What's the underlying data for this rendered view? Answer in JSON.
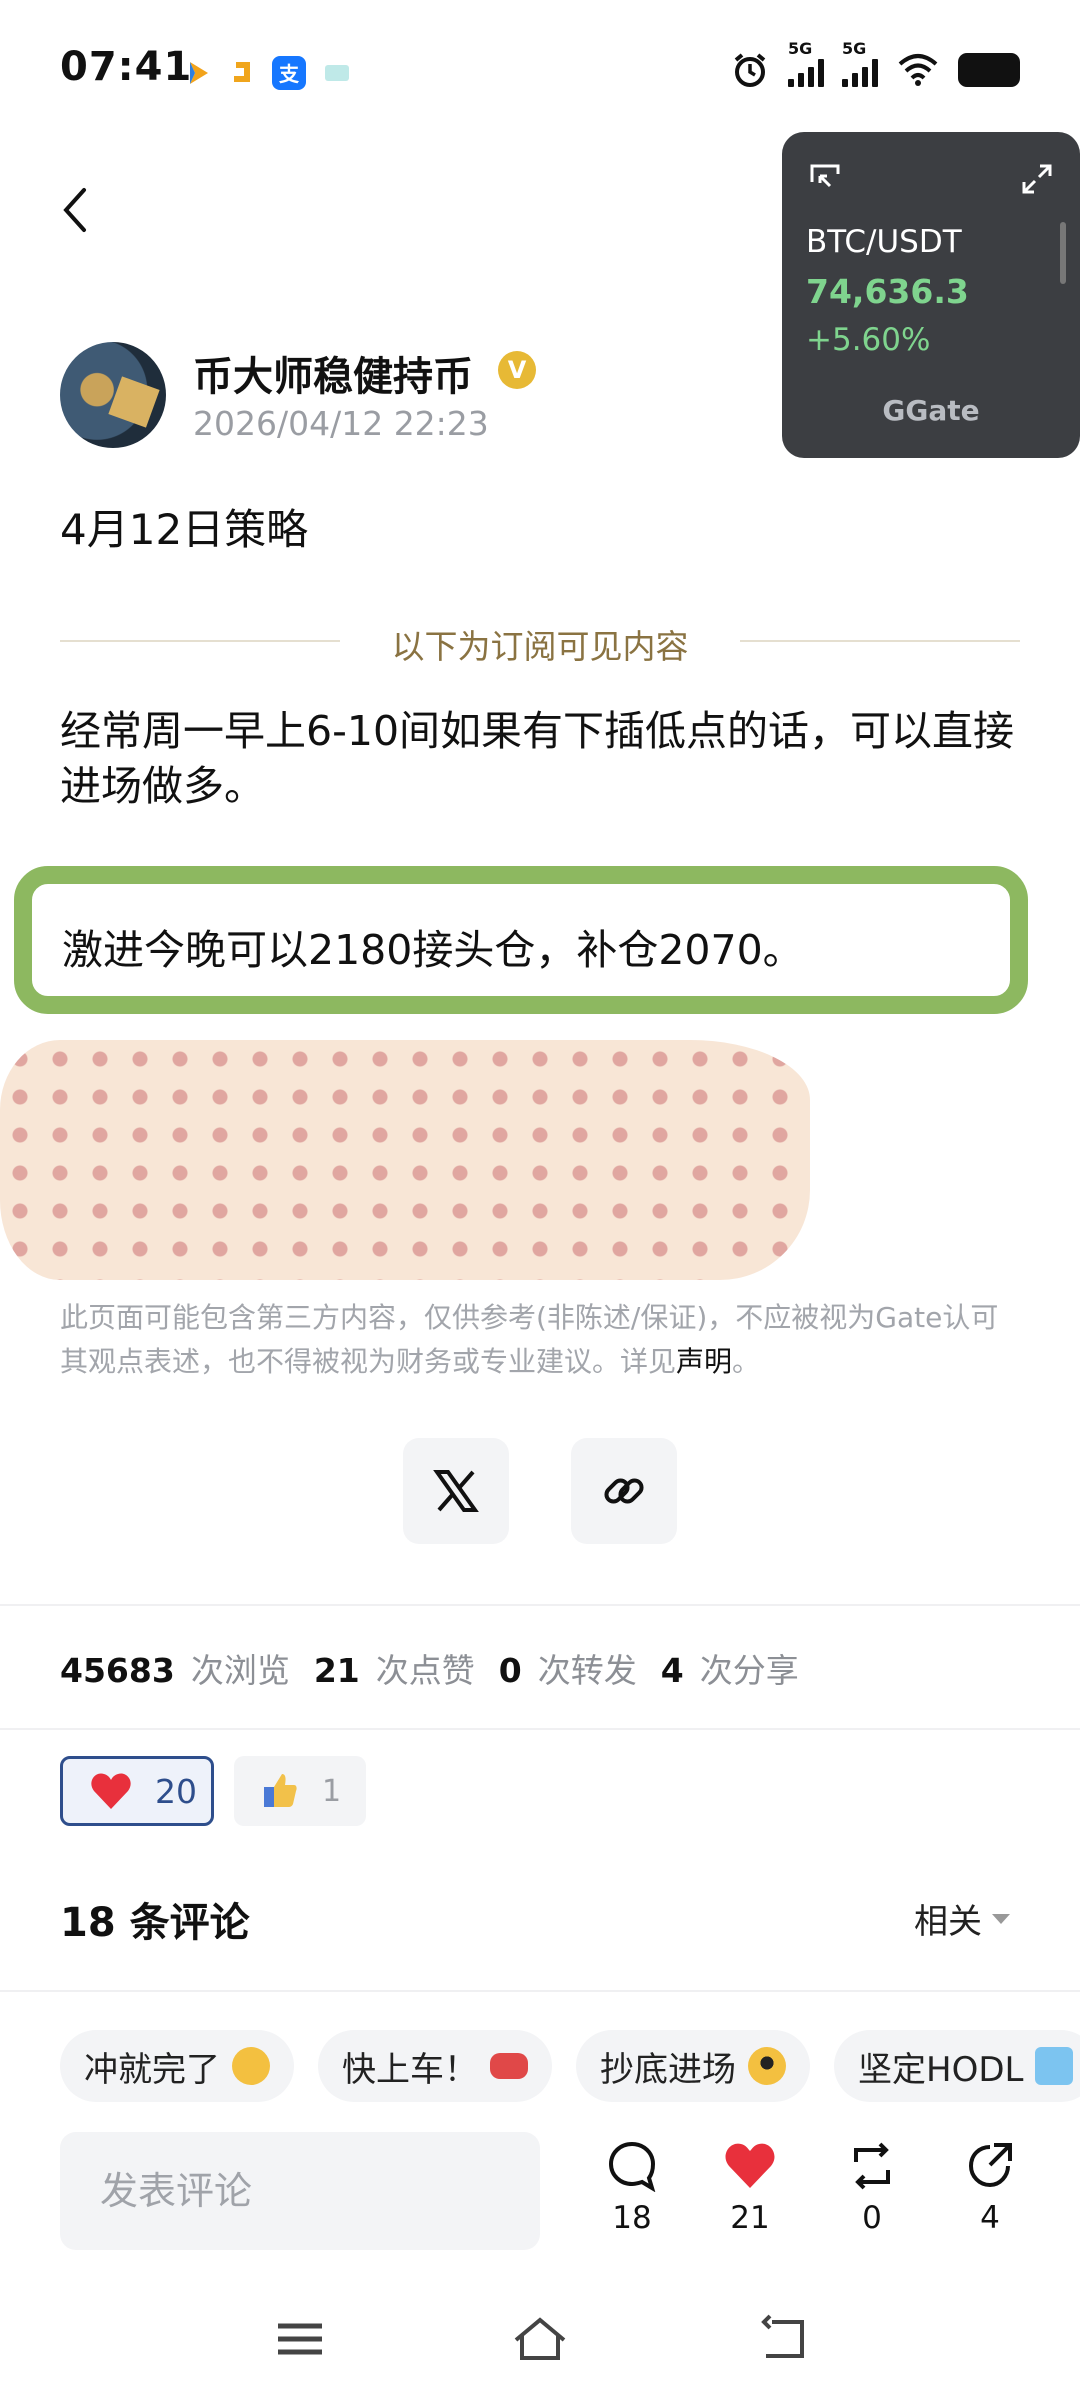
{
  "status_bar": {
    "time": "07:41",
    "signal_label_1": "5G",
    "signal_label_2": "5G",
    "icons": [
      "app-arrow-icon",
      "app-square-icon",
      "alipay-icon",
      "app-card-icon",
      "alarm-icon",
      "signal-icon",
      "wifi-icon",
      "battery-icon"
    ]
  },
  "ticker": {
    "pair": "BTC/USDT",
    "price": "74,636.3",
    "change": "+5.60%",
    "brand": "Gate",
    "price_color": "#7fd48e"
  },
  "author": {
    "name": "币大师稳健持币",
    "post_time": "2026/04/12 22:23",
    "verified_icon": "verified-badge-icon"
  },
  "post": {
    "title": "4月12日策略",
    "subscriber_divider": "以下为订阅可见内容",
    "paragraph": "经常周一早上6-10间如果有下插低点的话，可以直接进场做多。",
    "highlight": "激进今晚可以2180接头仓，补仓2070。",
    "disclaimer": "此页面可能包含第三方内容，仅供参考(非陈述/保证)，不应被视为Gate认可其观点表述，也不得被视为财务或专业建议。详见",
    "disclaimer_link": "声明",
    "disclaimer_end": "。"
  },
  "stats": {
    "views": "45683",
    "views_label": "次浏览",
    "likes": "21",
    "likes_label": "次点赞",
    "reposts": "0",
    "reposts_label": "次转发",
    "shares": "4",
    "shares_label": "次分享"
  },
  "reactions": {
    "heart_count": "20",
    "thumb_count": "1"
  },
  "comments": {
    "title": "18 条评论",
    "sort": "相关",
    "chips": [
      "冲就完了",
      "快上车！",
      "抄底进场",
      "坚定HODL"
    ],
    "input_placeholder": "发表评论"
  },
  "actions": {
    "comment_count": "18",
    "like_count": "21",
    "repost_count": "0",
    "share_count": "4"
  },
  "colors": {
    "highlight_border": "#8db860",
    "subscriber_text": "#8a7342",
    "like_border": "#2e4e8c"
  }
}
